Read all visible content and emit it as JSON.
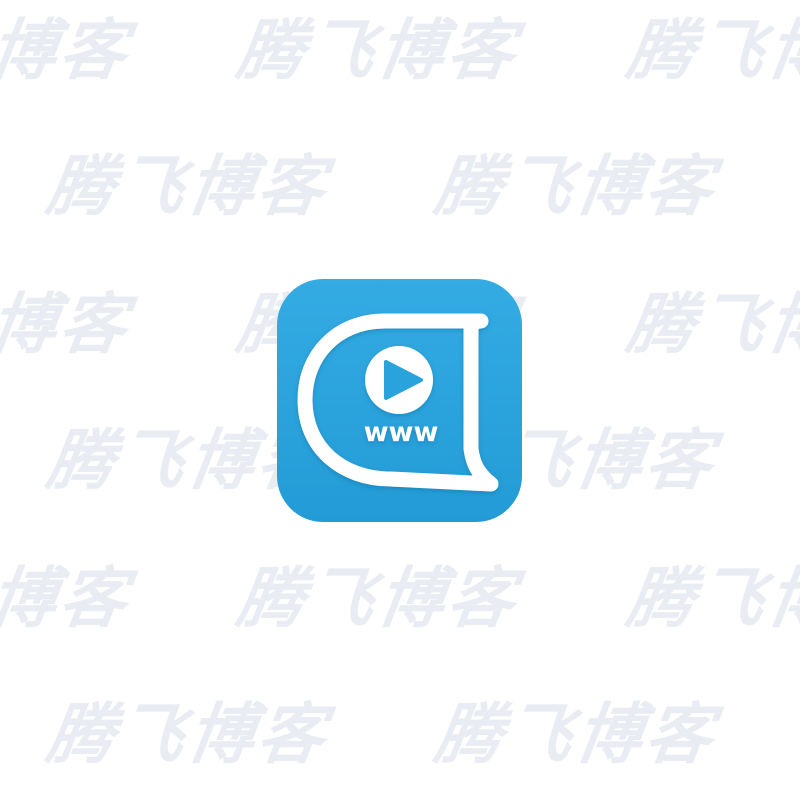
{
  "watermark": {
    "text": "腾飞博客",
    "color": "#e9ecf3"
  },
  "app_icon": {
    "name": "browser-video-app-icon",
    "label": "www",
    "background_color": "#2aa3dd",
    "foreground_color": "#ffffff",
    "glyphs": [
      "play-icon",
      "speech-bubble-icon"
    ]
  }
}
